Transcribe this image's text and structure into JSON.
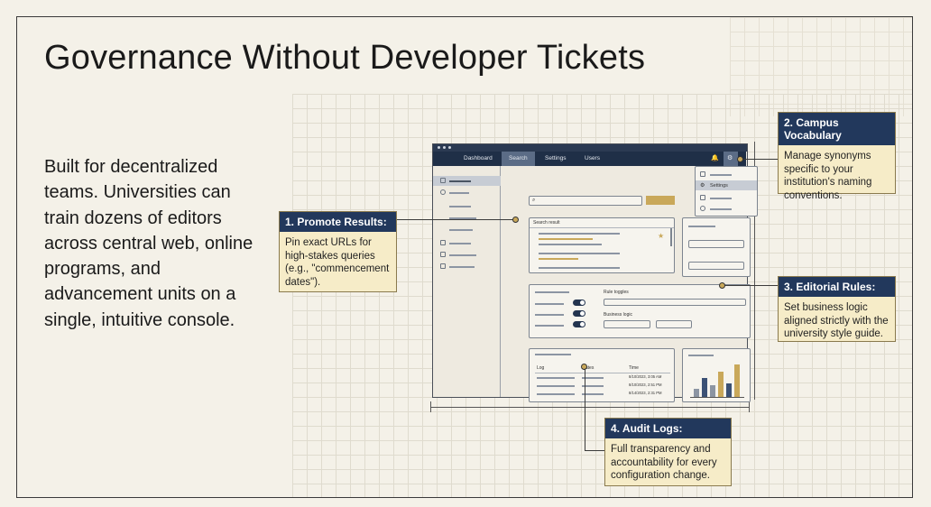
{
  "title": "Governance Without Developer Tickets",
  "description": "Built for decentralized teams. Universities can train dozens of editors across central web, online programs, and advancement units on a single, intuitive console.",
  "app": {
    "nav": [
      "Dashboard",
      "Search",
      "Settings",
      "Users"
    ],
    "active_nav": "Search",
    "settings_menu_item": "Settings",
    "search_result_label": "Search result",
    "rule_toggles_label": "Rule toggles",
    "business_logic_label": "Business logic",
    "log_headers": [
      "Log",
      "Gates",
      "Time"
    ],
    "log_times": [
      "8/10/2023, 3:05 AM",
      "8/10/2023, 2:51 PM",
      "8/14/2023, 2:31 PM"
    ],
    "chart_values": [
      0.25,
      0.55,
      0.35,
      0.75,
      0.4,
      0.95
    ],
    "colors": {
      "navy": "#22385c",
      "gold": "#c9a85a",
      "cream": "#f6ecc8"
    }
  },
  "callouts": {
    "promote": {
      "title": "1. Promote Results:",
      "body": "Pin exact URLs for high-stakes queries (e.g., \"commencement dates\")."
    },
    "vocab": {
      "title": "2. Campus Vocabulary",
      "body": "Manage synonyms specific to your institution's naming conventions."
    },
    "rules": {
      "title": "3. Editorial Rules:",
      "body": "Set business logic aligned strictly with the university style guide."
    },
    "audit": {
      "title": "4. Audit Logs:",
      "body": "Full transparency and accountability for every configuration change."
    }
  }
}
